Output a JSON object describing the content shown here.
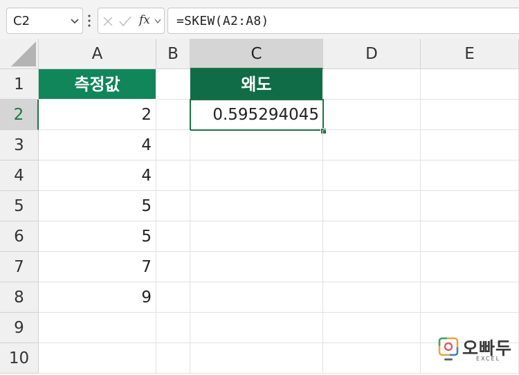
{
  "formula_bar": {
    "name_box": "C2",
    "fx_label": "fx",
    "formula": "=SKEW(A2:A8)"
  },
  "columns": [
    "A",
    "B",
    "C",
    "D",
    "E"
  ],
  "rows": [
    "1",
    "2",
    "3",
    "4",
    "5",
    "6",
    "7",
    "8",
    "9",
    "10"
  ],
  "cells": {
    "A1": "측정값",
    "A2": "2",
    "A3": "4",
    "A4": "4",
    "A5": "5",
    "A6": "5",
    "A7": "7",
    "A8": "9",
    "C1": "왜도",
    "C2": "0.595294045"
  },
  "watermark": {
    "word": "오빠두",
    "sub": "EXCEL"
  },
  "colors": {
    "accent": "#1e7145",
    "header_a_fill": "#11865b",
    "header_c_fill": "#0f6c47"
  }
}
